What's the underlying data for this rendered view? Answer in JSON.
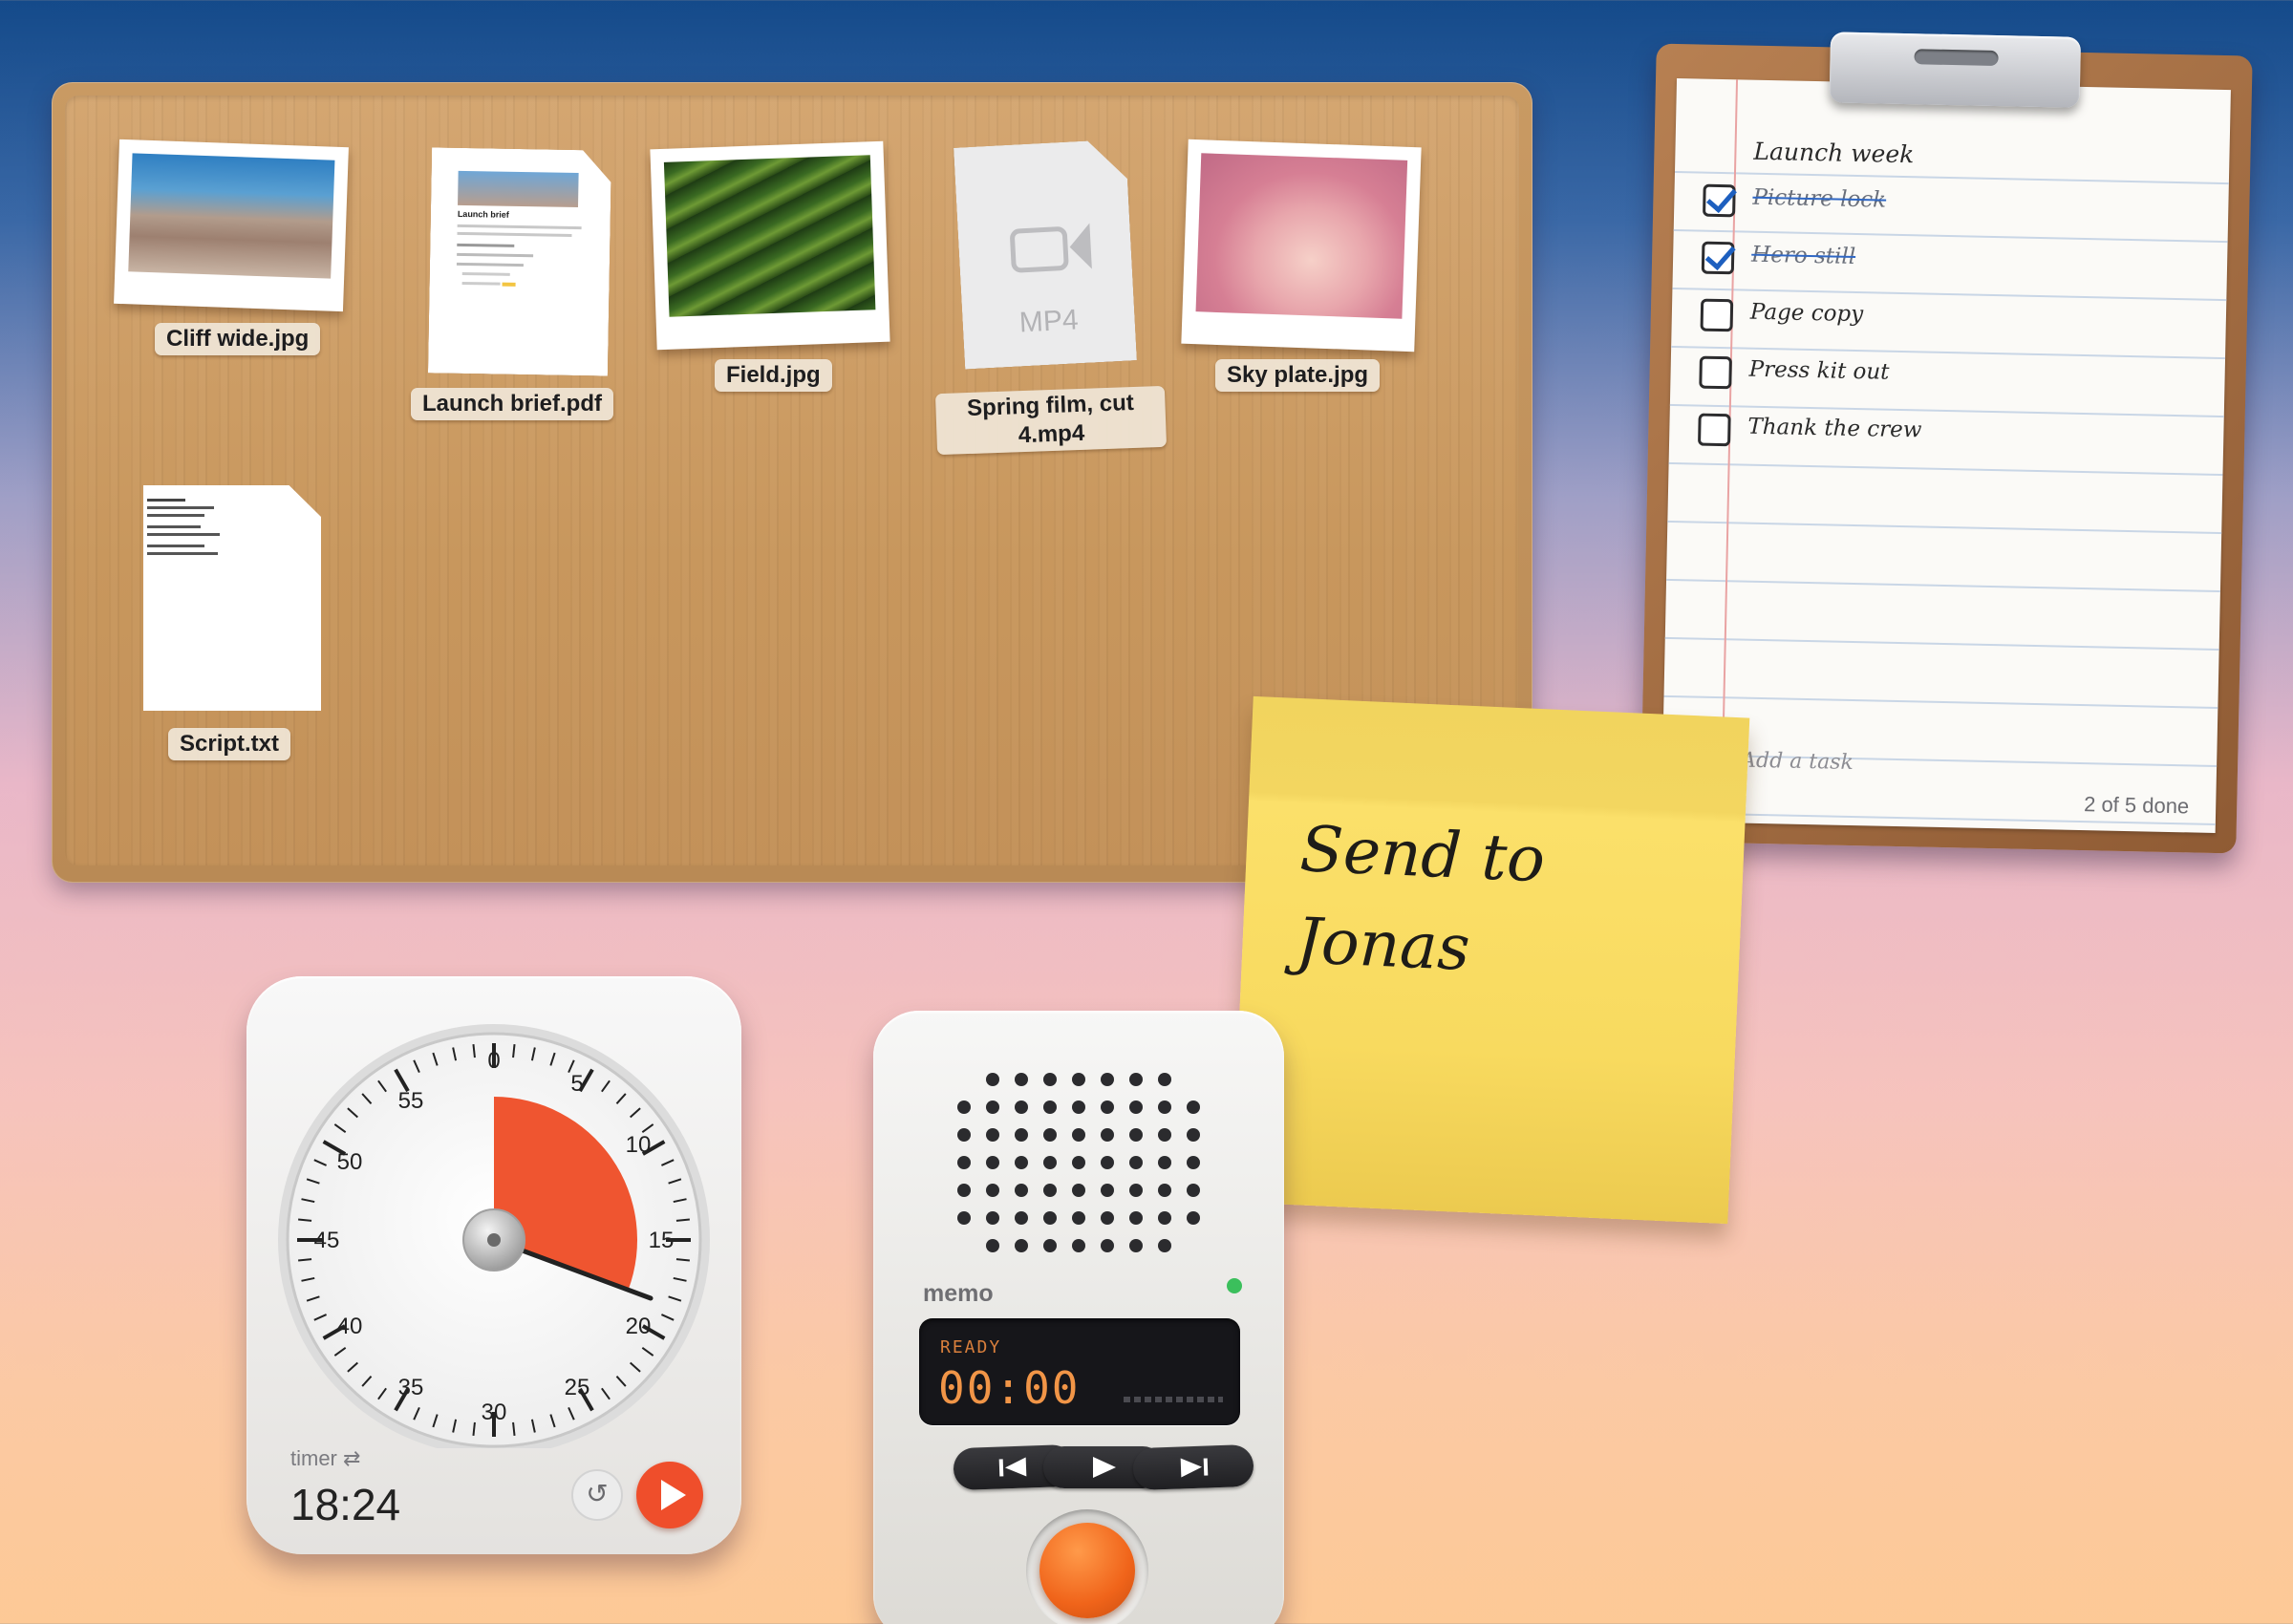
{
  "board": {
    "files": [
      {
        "name": "Cliff wide.jpg",
        "type": "photo",
        "icon": "photo-cliff-icon"
      },
      {
        "name": "Launch brief.pdf",
        "type": "pdf",
        "icon": "pdf-document-icon",
        "preview": {
          "title": "Launch brief"
        }
      },
      {
        "name": "Field.jpg",
        "type": "photo",
        "icon": "photo-field-icon"
      },
      {
        "name": "Spring film, cut 4.mp4",
        "type": "video",
        "icon": "video-camera-icon",
        "badge": "MP4"
      },
      {
        "name": "Sky plate.jpg",
        "type": "photo",
        "icon": "photo-sky-icon"
      },
      {
        "name": "Script.txt",
        "type": "text",
        "icon": "text-document-icon"
      }
    ]
  },
  "clipboard": {
    "title": "Launch week",
    "tasks": [
      {
        "label": "Picture lock",
        "done": true
      },
      {
        "label": "Hero still",
        "done": true
      },
      {
        "label": "Page copy",
        "done": false
      },
      {
        "label": "Press kit out",
        "done": false
      },
      {
        "label": "Thank the crew",
        "done": false
      }
    ],
    "add_placeholder": "Add a task",
    "progress_text": "2 of 5 done"
  },
  "sticky": {
    "text": "Send to Jonas",
    "color": "#f8da5f"
  },
  "timer": {
    "dial_numbers": [
      "0",
      "5",
      "10",
      "15",
      "20",
      "25",
      "30",
      "35",
      "40",
      "45",
      "50",
      "55"
    ],
    "remaining_minutes": 18.4,
    "label": "timer",
    "mode_icon": "swap-arrows-icon",
    "time": "18:24",
    "accent": "#ef4e2b"
  },
  "memo": {
    "brand": "memo",
    "status": "READY",
    "time": "00:00",
    "led_color": "#3bbf5c",
    "controls": [
      "previous-icon",
      "play-icon",
      "next-icon"
    ],
    "record_color": "#f0641a"
  }
}
